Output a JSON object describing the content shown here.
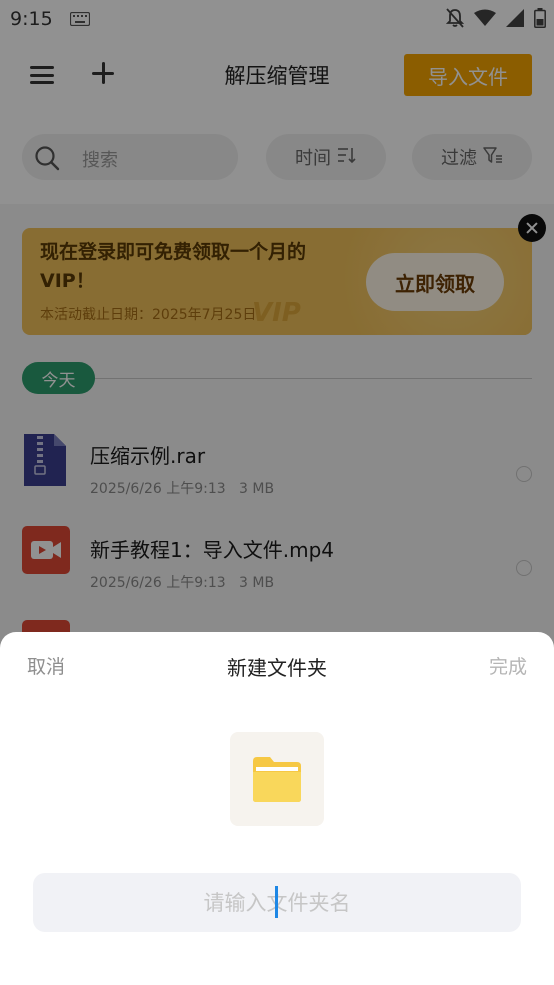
{
  "status_bar": {
    "time": "9:15",
    "icons": [
      "keyboard-icon",
      "notifications-off-icon",
      "wifi-icon",
      "signal-icon",
      "battery-icon"
    ]
  },
  "topbar": {
    "menu_icon": "menu-icon",
    "add_icon": "plus-icon",
    "title": "解压缩管理",
    "import_label": "导入文件"
  },
  "filterbar": {
    "search_placeholder": "搜索",
    "sort_label": "时间",
    "filter_label": "过滤"
  },
  "banner": {
    "title": "现在登录即可免费领取一个月的VIP！",
    "subtitle": "本活动截止日期：2025年7月25日",
    "watermark": "VIP",
    "claim_label": "立即领取",
    "close_icon": "close-icon"
  },
  "date_group": {
    "label": "今天"
  },
  "files": [
    {
      "name": "压缩示例.rar",
      "date": "2025/6/26 上午9:13",
      "size": "3 MB",
      "icon": "rar-file-icon"
    },
    {
      "name": "新手教程1：导入文件.mp4",
      "date": "2025/6/26 上午9:13",
      "size": "3 MB",
      "icon": "video-file-icon"
    }
  ],
  "sheet": {
    "cancel_label": "取消",
    "title": "新建文件夹",
    "done_label": "完成",
    "folder_icon": "folder-icon",
    "input_placeholder": "请输入文件夹名",
    "input_value": ""
  },
  "colors": {
    "accent_orange": "#f5a400",
    "banner_gold": "#f0c05a",
    "date_chip_green": "#2c9d6d",
    "video_red": "#e04836",
    "rar_navy": "#3a3f8f",
    "caret_blue": "#1e87e5",
    "folder_yellow": "#f6c844"
  }
}
